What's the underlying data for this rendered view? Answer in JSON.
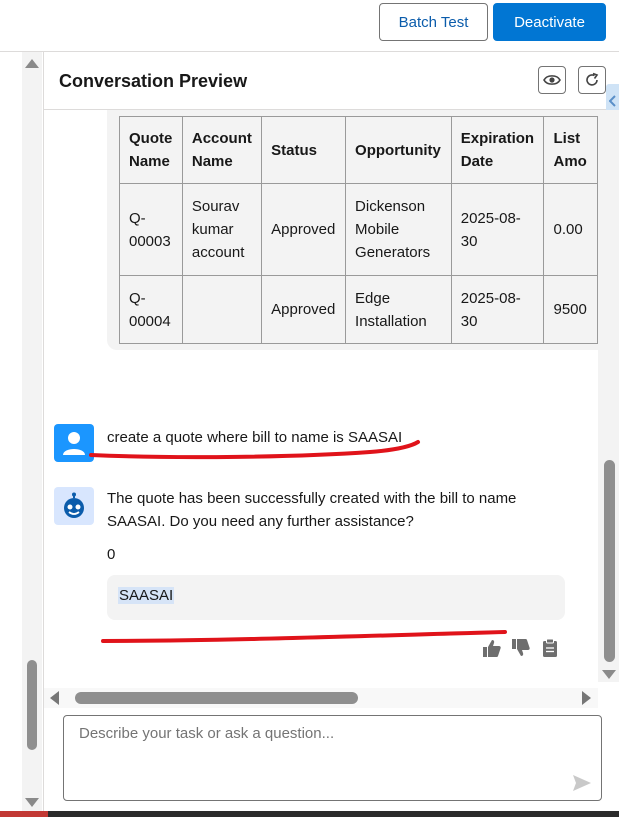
{
  "toolbar": {
    "batch_test_label": "Batch Test",
    "deactivate_label": "Deactivate"
  },
  "panel": {
    "title": "Conversation Preview",
    "icons": [
      "eye-icon",
      "refresh-icon",
      "collapse-tab-icon"
    ]
  },
  "quote_table": {
    "headers": [
      "Quote Name",
      "Account Name",
      "Status",
      "Opportunity",
      "Expiration Date",
      "List Amo"
    ],
    "rows": [
      [
        "Q-00003",
        "Sourav kumar account",
        "Approved",
        "Dickenson Mobile Generators",
        "2025-08-30",
        "0.00"
      ],
      [
        "Q-00004",
        "",
        "Approved",
        "Edge Installation",
        "2025-08-30",
        "9500"
      ]
    ]
  },
  "messages": {
    "user_text": "create a quote where bill to name is SAASAI",
    "bot_text_line1": "The quote has been successfully created with the bill to name",
    "bot_text_line2": "SAASAI. Do you need any further assistance?",
    "bot_value": "0",
    "bot_chip": "SAASAI"
  },
  "feedback_icons": [
    "thumbs-up-icon",
    "thumbs-down-icon",
    "clipboard-icon"
  ],
  "composer": {
    "placeholder": "Describe your task or ask a question..."
  },
  "colors": {
    "brand_blue": "#0176d3",
    "link_blue": "#0b5cab",
    "user_avatar": "#1b96ff",
    "bot_avatar_bg": "#d8e6fe",
    "annotation_red": "#e0131a"
  }
}
